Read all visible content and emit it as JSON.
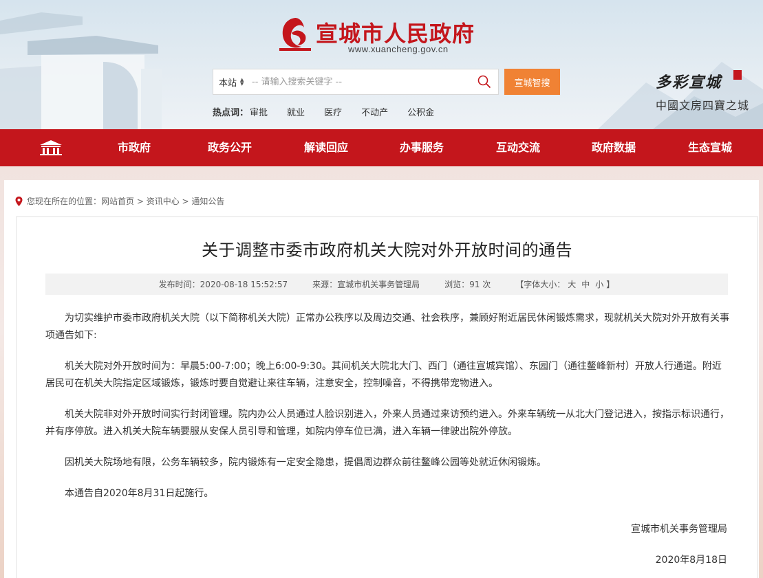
{
  "header": {
    "site_title": "宣城市人民政府",
    "site_url": "www.xuancheng.gov.cn",
    "search": {
      "scope": "本站",
      "placeholder": "-- 请输入搜索关键字 --",
      "button": "宣城智搜"
    },
    "hotwords": {
      "label": "热点词：",
      "items": [
        "审批",
        "就业",
        "医疗",
        "不动产",
        "公积金"
      ]
    },
    "slogan": {
      "main": "多彩宣城",
      "sub": "中國文房四寶之城"
    },
    "colors": {
      "brand_red": "#c4161c",
      "search_orange": "#f08234"
    }
  },
  "nav": {
    "home_icon": "building-icon",
    "items": [
      "市政府",
      "政务公开",
      "解读回应",
      "办事服务",
      "互动交流",
      "政府数据",
      "生态宣城"
    ]
  },
  "breadcrumb": {
    "prefix": "您现在所在的位置：",
    "items": [
      "网站首页",
      "资讯中心",
      "通知公告"
    ],
    "separator": " > "
  },
  "article": {
    "title": "关于调整市委市政府机关大院对外开放时间的通告",
    "meta": {
      "publish": "发布时间：2020-08-18 15:52:57",
      "source": "来源：宣城市机关事务管理局",
      "views": "浏览：91 次",
      "font_size_open": "【字体大小：",
      "font_large": "大",
      "font_medium": "中",
      "font_small": "小",
      "font_size_close": "】"
    },
    "paragraphs": [
      "为切实维护市委市政府机关大院（以下简称机关大院）正常办公秩序以及周边交通、社会秩序，兼顾好附近居民休闲锻炼需求，现就机关大院对外开放有关事项通告如下:",
      "机关大院对外开放时间为：早晨5:00-7:00；晚上6:00-9:30。其间机关大院北大门、西门（通往宣城宾馆）、东园门（通往鳌峰新村）开放人行通道。附近居民可在机关大院指定区域锻炼，锻炼时要自觉避让来往车辆，注意安全，控制噪音，不得携带宠物进入。",
      "机关大院非对外开放时间实行封闭管理。院内办公人员通过人脸识别进入，外来人员通过来访预约进入。外来车辆统一从北大门登记进入，按指示标识通行，并有序停放。进入机关大院车辆要服从安保人员引导和管理，如院内停车位已满，进入车辆一律驶出院外停放。",
      "因机关大院场地有限，公务车辆较多，院内锻炼有一定安全隐患，提倡周边群众前往鳌峰公园等处就近休闲锻炼。",
      "本通告自2020年8月31日起施行。"
    ],
    "signature": "宣城市机关事务管理局",
    "date": "2020年8月18日"
  }
}
